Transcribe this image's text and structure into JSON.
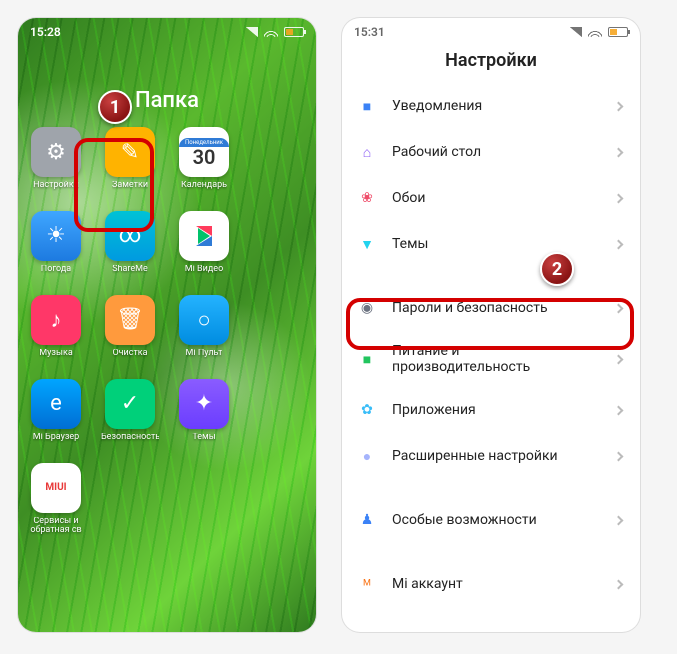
{
  "left": {
    "time": "15:28",
    "folder_title": "Папка",
    "apps": [
      {
        "name": "settings",
        "label": "Настройки",
        "glyph": "⚙"
      },
      {
        "name": "notes",
        "label": "Заметки",
        "glyph": "✎"
      },
      {
        "name": "calendar",
        "label": "Календарь",
        "day_label": "Понедельник",
        "day_num": "30"
      },
      {
        "name": "weather",
        "label": "Погода",
        "glyph": "☀"
      },
      {
        "name": "shareme",
        "label": "ShareMe",
        "glyph": "∞"
      },
      {
        "name": "video",
        "label": "Mi Видео"
      },
      {
        "name": "music",
        "label": "Музыка",
        "glyph": "♪"
      },
      {
        "name": "cleaner",
        "label": "Очистка",
        "glyph": "🗑"
      },
      {
        "name": "remote",
        "label": "Mi Пульт",
        "glyph": "○"
      },
      {
        "name": "browser",
        "label": "Mi Браузер",
        "glyph": "e"
      },
      {
        "name": "security",
        "label": "Безопасность",
        "glyph": "✓"
      },
      {
        "name": "themes",
        "label": "Темы",
        "glyph": "✦"
      },
      {
        "name": "services",
        "label": "Сервисы и обратная св",
        "glyph": "MIUI"
      }
    ]
  },
  "right": {
    "time": "15:31",
    "title": "Настройки",
    "rows": [
      {
        "name": "notifications",
        "label": "Уведомления",
        "color": "#3b82f6",
        "glyph": "■"
      },
      {
        "name": "home",
        "label": "Рабочий стол",
        "color": "#8b5cf6",
        "glyph": "⌂"
      },
      {
        "name": "wallpaper",
        "label": "Обои",
        "color": "#ef4d6a",
        "glyph": "❀"
      },
      {
        "name": "themes",
        "label": "Темы",
        "color": "#22d3ee",
        "glyph": "▼"
      },
      {
        "gap": true
      },
      {
        "name": "security",
        "label": "Пароли и безопасность",
        "color": "#6b7280",
        "glyph": "◉",
        "highlight": true
      },
      {
        "name": "battery",
        "label": "Питание и производительность",
        "color": "#22c55e",
        "glyph": "■"
      },
      {
        "name": "apps",
        "label": "Приложения",
        "color": "#38bdf8",
        "glyph": "✿"
      },
      {
        "name": "advanced",
        "label": "Расширенные настройки",
        "color": "#a5b4fc",
        "glyph": "●"
      },
      {
        "gap": true
      },
      {
        "name": "accessibility",
        "label": "Особые возможности",
        "color": "#3b82f6",
        "glyph": "♟"
      },
      {
        "gap": true
      },
      {
        "name": "mi-account",
        "label": "Mi аккаунт",
        "color": "#f97316",
        "glyph": "ᴹ"
      }
    ]
  },
  "badges": {
    "one": "1",
    "two": "2"
  }
}
